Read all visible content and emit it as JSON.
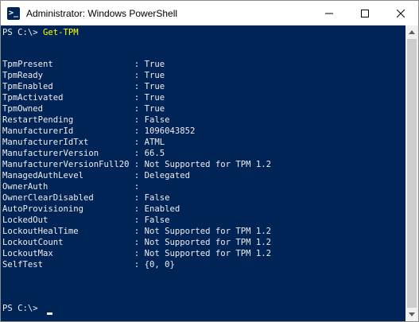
{
  "window": {
    "title": "Administrator: Windows PowerShell",
    "icon_glyph": ">_"
  },
  "console": {
    "prompt1": "PS C:\\> ",
    "command": "Get-TPM",
    "properties": [
      {
        "key": "TpmPresent",
        "value": "True"
      },
      {
        "key": "TpmReady",
        "value": "True"
      },
      {
        "key": "TpmEnabled",
        "value": "True"
      },
      {
        "key": "TpmActivated",
        "value": "True"
      },
      {
        "key": "TpmOwned",
        "value": "True"
      },
      {
        "key": "RestartPending",
        "value": "False"
      },
      {
        "key": "ManufacturerId",
        "value": "1096043852"
      },
      {
        "key": "ManufacturerIdTxt",
        "value": "ATML"
      },
      {
        "key": "ManufacturerVersion",
        "value": "66.5"
      },
      {
        "key": "ManufacturerVersionFull20",
        "value": "Not Supported for TPM 1.2"
      },
      {
        "key": "ManagedAuthLevel",
        "value": "Delegated"
      },
      {
        "key": "OwnerAuth",
        "value": ""
      },
      {
        "key": "OwnerClearDisabled",
        "value": "False"
      },
      {
        "key": "AutoProvisioning",
        "value": "Enabled"
      },
      {
        "key": "LockedOut",
        "value": "False"
      },
      {
        "key": "LockoutHealTime",
        "value": "Not Supported for TPM 1.2"
      },
      {
        "key": "LockoutCount",
        "value": "Not Supported for TPM 1.2"
      },
      {
        "key": "LockoutMax",
        "value": "Not Supported for TPM 1.2"
      },
      {
        "key": "SelfTest",
        "value": "{0, 0}"
      }
    ],
    "prompt2": "PS C:\\> "
  },
  "colors": {
    "console_bg": "#012456",
    "console_fg": "#eeedf0",
    "command_fg": "#ffff00"
  },
  "icons": [
    "powershell-icon",
    "minimize-icon",
    "maximize-icon",
    "close-icon",
    "scroll-up-arrow-icon",
    "scroll-down-arrow-icon"
  ]
}
